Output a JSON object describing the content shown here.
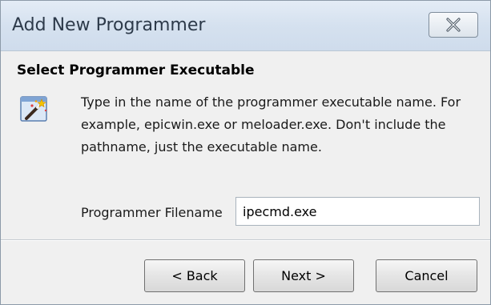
{
  "window": {
    "title": "Add New Programmer",
    "close_icon": "close-x-icon"
  },
  "page": {
    "heading": "Select Programmer Executable",
    "icon": "wizard-wand-icon",
    "description": "Type in the name of the programmer executable name. For example, epicwin.exe or meloader.exe.  Don't include the pathname, just the executable name."
  },
  "form": {
    "filename_label": "Programmer Filename",
    "filename_value": "ipecmd.exe"
  },
  "buttons": {
    "back": "< Back",
    "next": "Next >",
    "cancel": "Cancel"
  }
}
